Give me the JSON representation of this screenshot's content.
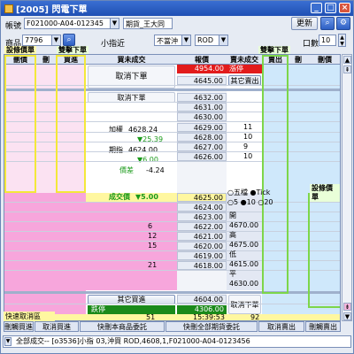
{
  "window": {
    "title": "[2005] 閃電下單"
  },
  "top": {
    "account_label": "帳號",
    "account_value": "F021000-A04-012345",
    "customer": "期貨_王大同",
    "refresh_label": "更新",
    "product_label": "商品",
    "product_code": "7796",
    "product_name": "小指近",
    "condition": "不當沖",
    "order_type": "ROD",
    "qty_label": "口數",
    "qty_value": "10"
  },
  "columns": {
    "del_buy": "刪價",
    "buy_cond": "買進",
    "buy_pending": "買未成交",
    "price": "報價",
    "sell_pending": "賣未成交",
    "sell_cond": "賣出",
    "del_sell": "刪價",
    "buy_num": "刪",
    "sell_num": "刪"
  },
  "tags": {
    "trigger_price_buy": "設條價單",
    "double_click_buy": "雙擊下單",
    "double_click_sell": "雙擊下單",
    "trigger_price_sell": "設條價單"
  },
  "controls": {
    "cancel_buy_order": "取消下單",
    "cancel_sell_order": "取消下單",
    "limit_up": "漲停",
    "limit_up_price": "4954.00",
    "other_sell": "其它賣出",
    "other_buy": "其它買進",
    "limit_down": "跌停",
    "limit_down_price": "4306.00",
    "cancel_order_row": "取消下單"
  },
  "quote": {
    "weighted_label": "加權",
    "weighted_value": "4628.24",
    "change_weighted": "▼25.39",
    "futures_label": "期指",
    "futures_value": "4624.00",
    "change_futures": "▼6.00",
    "basis_label": "價差",
    "basis_value": "-4.24",
    "last_label": "成交價",
    "last_change": "▼5.00",
    "tick_five": "五檔",
    "tick_label": "Tick",
    "radio_5": "5",
    "radio_10": "10",
    "radio_20": "20",
    "open_label": "開",
    "open_value": "4670.00",
    "high_label": "高",
    "high_value": "4675.00",
    "low_label": "低",
    "low_value": "4615.00",
    "settle_label": "平",
    "settle_value": "4630.00"
  },
  "prices": [
    "4645.00",
    "4632.00",
    "4631.00",
    "4630.00",
    "4629.00",
    "4628.00",
    "4627.00",
    "4626.00",
    "4625.00",
    "4624.00",
    "4623.00",
    "4622.00",
    "4621.00",
    "4620.00",
    "4619.00",
    "4618.00",
    "4604.00"
  ],
  "price_last": "4625.00",
  "price_limit_row": "4306.00",
  "sell_qty": [
    "",
    "",
    "",
    "",
    "11",
    "10",
    "9",
    "10",
    "",
    "",
    "",
    "",
    "",
    "",
    "",
    "",
    ""
  ],
  "buy_qty": [
    "",
    "",
    "",
    "",
    "",
    "",
    "",
    "",
    "",
    "",
    "",
    "6",
    "12",
    "15",
    "",
    "21",
    ""
  ],
  "totals": {
    "buy": "51",
    "time": "15:39:53",
    "sell": "92"
  },
  "bottom": {
    "quick_cancel": "快速取消區",
    "b1": "刪觸買進",
    "b2": "取消買進",
    "b3": "快刪本商品委託",
    "b4": "快刪全部期貨委託",
    "b5": "取消賣出",
    "b6": "刪觸賣出"
  },
  "status": "全部成交-- [o3536]小指 03,沖買 ROD,4608,1,F021000-A04-0123456"
}
